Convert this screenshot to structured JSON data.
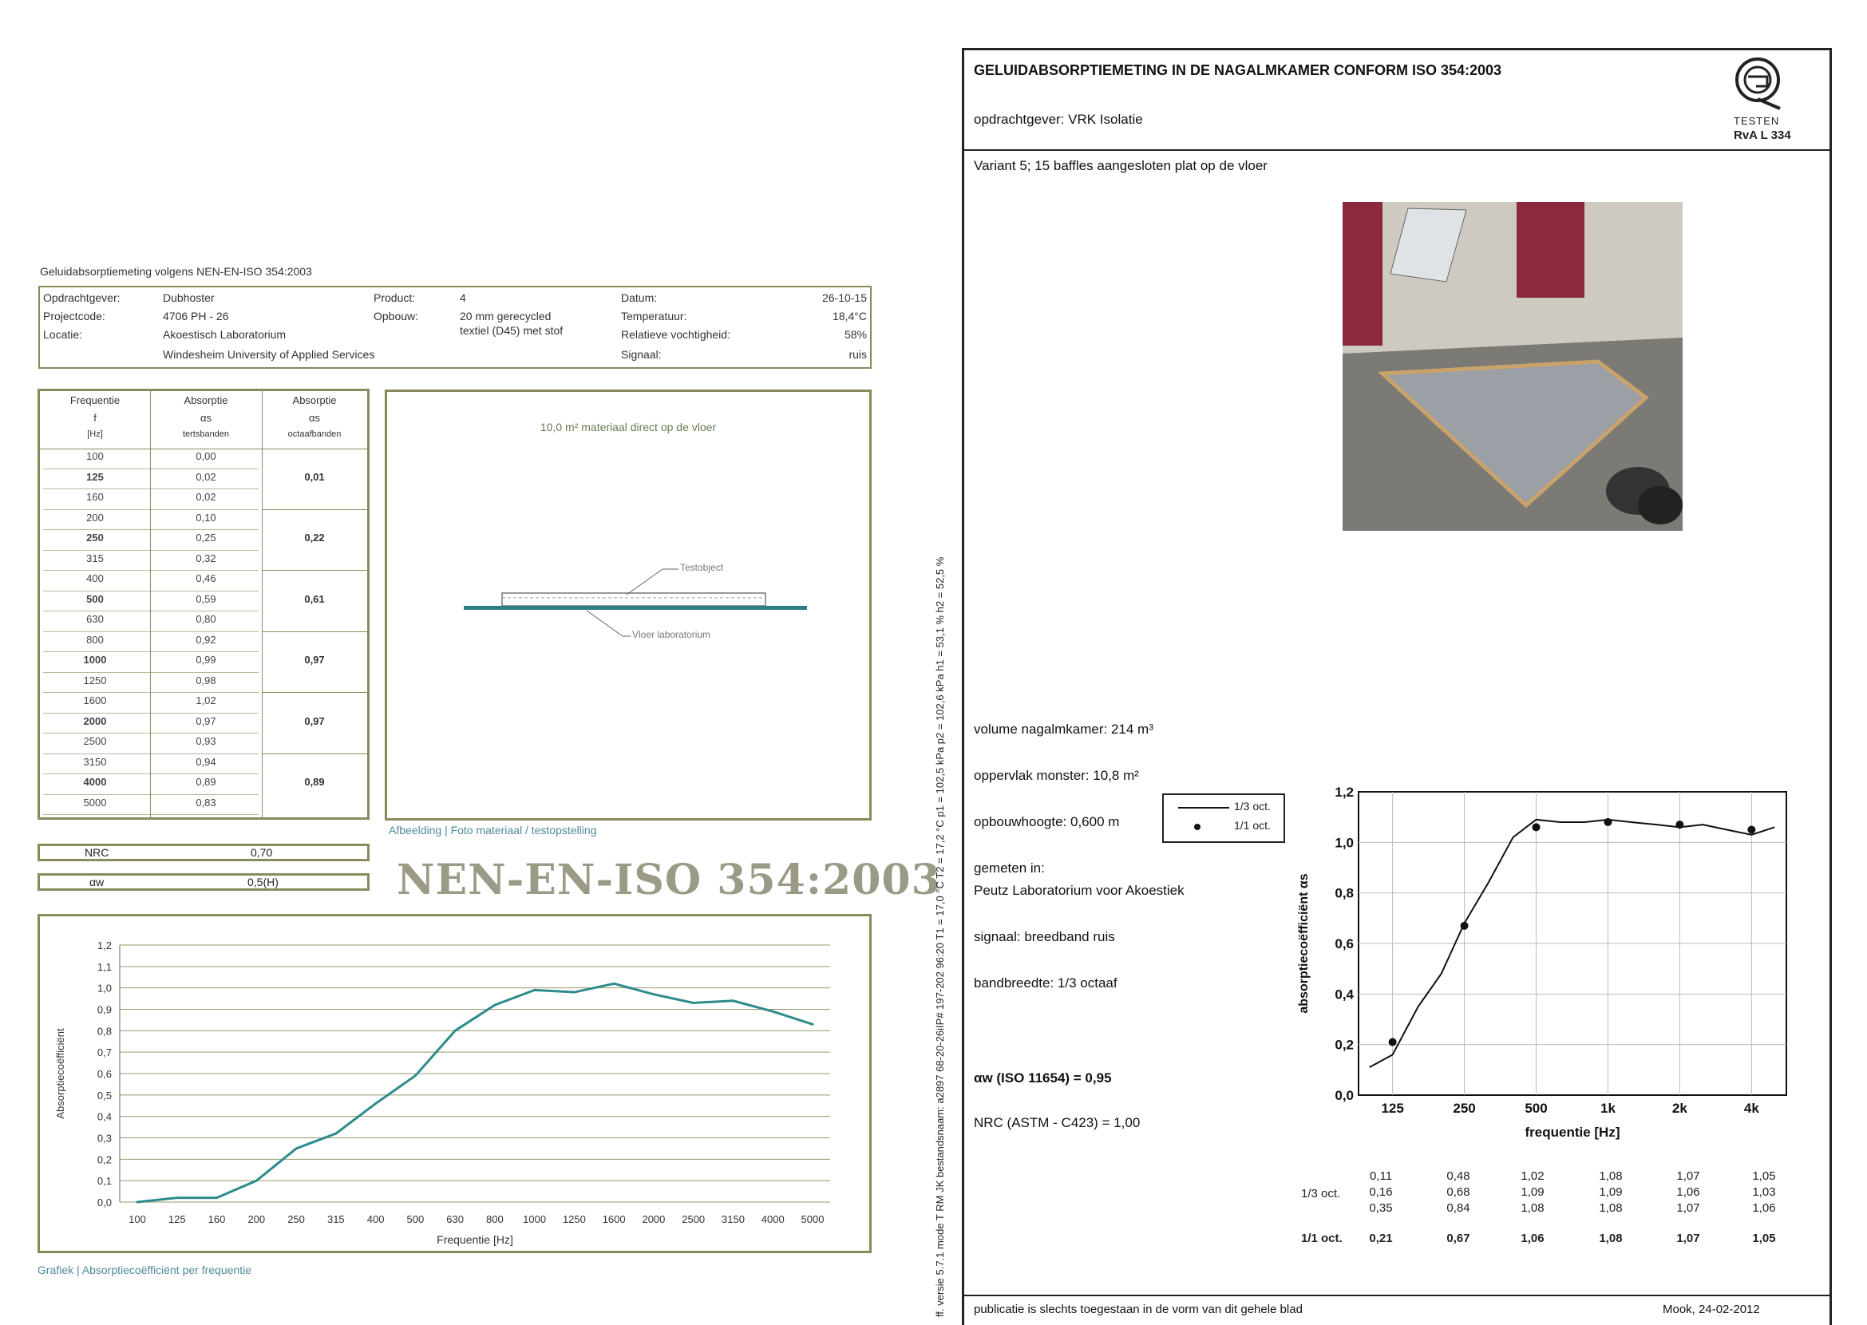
{
  "left_report": {
    "title": "Geluidabsorptiemeting volgens NEN-EN-ISO 354:2003",
    "meta": {
      "client_label": "Opdrachtgever:",
      "client_value": "Dubhoster",
      "project_label": "Projectcode:",
      "project_value": "4706 PH - 26",
      "location_label": "Locatie:",
      "location_value": "Akoestisch Laboratorium",
      "location_value2": "Windesheim University of Applied Services",
      "product_label": "Product:",
      "product_value": "4",
      "build_label": "Opbouw:",
      "build_value": "20 mm gerecycled",
      "build_value2": "textiel (D45) met stof",
      "date_label": "Datum:",
      "date_value": "26-10-15",
      "temp_label": "Temperatuur:",
      "temp_value": "18,4°C",
      "humidity_label": "Relatieve vochtigheid:",
      "humidity_value": "58%",
      "signal_label": "Signaal:",
      "signal_value": "ruis"
    },
    "table": {
      "headers": [
        [
          "Frequentie",
          "f",
          "[Hz]"
        ],
        [
          "Absorptie",
          "αs",
          "tertsbanden"
        ],
        [
          "Absorptie",
          "αs",
          "octaafbanden"
        ]
      ],
      "rows": [
        {
          "f": "100",
          "third": "0,00"
        },
        {
          "f": "125",
          "third": "0,02"
        },
        {
          "f": "160",
          "third": "0,02"
        },
        {
          "f": "200",
          "third": "0,10"
        },
        {
          "f": "250",
          "third": "0,25"
        },
        {
          "f": "315",
          "third": "0,32"
        },
        {
          "f": "400",
          "third": "0,46"
        },
        {
          "f": "500",
          "third": "0,59"
        },
        {
          "f": "630",
          "third": "0,80"
        },
        {
          "f": "800",
          "third": "0,92"
        },
        {
          "f": "1000",
          "third": "0,99"
        },
        {
          "f": "1250",
          "third": "0,98"
        },
        {
          "f": "1600",
          "third": "1,02"
        },
        {
          "f": "2000",
          "third": "0,97"
        },
        {
          "f": "2500",
          "third": "0,93"
        },
        {
          "f": "3150",
          "third": "0,94"
        },
        {
          "f": "4000",
          "third": "0,89"
        },
        {
          "f": "5000",
          "third": "0,83"
        }
      ],
      "octave": [
        "0,01",
        "0,22",
        "0,61",
        "0,97",
        "0,97",
        "0,89"
      ]
    },
    "nrc_label": "NRC",
    "nrc_value": "0,70",
    "aw_label": "αw",
    "aw_value": "0,5(H)",
    "drawing_title": "10,0 m² materiaal direct op de vloer",
    "drawing_label_top": "Testobject",
    "drawing_label_bottom": "Vloer laboratorium",
    "drawing_caption": "Afbeelding | Foto materiaal / testopstelling",
    "standard_title": "NEN-EN-ISO 354:2003",
    "chart_caption": "Grafiek | Absorptiecoëfficiënt per frequentie"
  },
  "right_report": {
    "title": "GELUIDABSORPTIEMETING IN DE NAGALMKAMER CONFORM ISO 354:2003",
    "client": "opdrachtgever: VRK Isolatie",
    "logo_line1": "TESTEN",
    "logo_line2": "RvA L 334",
    "variant": "Variant 5; 15 baffles aangesloten plat op de vloer",
    "volume": "volume nagalmkamer: 214 m³",
    "area": "oppervlak monster: 10,8 m²",
    "height": "opbouwhoogte: 0,600 m",
    "measured_in": "gemeten in:",
    "lab": "Peutz Laboratorium voor Akoestiek",
    "signal": "signaal: breedband ruis",
    "bandwidth": "bandbreedte: 1/3 octaaf",
    "aw": "αw (ISO 11654) = 0,95",
    "nrc": "NRC (ASTM - C423) = 1,00",
    "legend_third": "1/3 oct.",
    "legend_oct": "1/1 oct.",
    "third_label": "1/3 oct.",
    "oct_label": "1/1 oct.",
    "values_rows": [
      [
        "0,11",
        "0,48",
        "1,02",
        "1,08",
        "1,07",
        "1,05"
      ],
      [
        "0,16",
        "0,68",
        "1,09",
        "1,09",
        "1,06",
        "1,03"
      ],
      [
        "0,35",
        "0,84",
        "1,08",
        "1,08",
        "1,07",
        "1,06"
      ]
    ],
    "oct_values": [
      "0,21",
      "0,67",
      "1,06",
      "1,08",
      "1,07",
      "1,05"
    ],
    "footer_left": "publicatie is slechts toegestaan in de vorm van dit gehele blad",
    "footer_right": "Mook, 24-02-2012",
    "side_text": "ff. versie 5.7.1 mode T RM  JK bestandsnaam: a2897 68-20-26iIP# 197-202  96:20 T1 = 17,0 °C T2 = 17,2 °C p1 = 102,5 kPa p2 = 102,6 kPa h1 = 53,1 % h2 = 52,5 %"
  },
  "chart_data": [
    {
      "type": "line",
      "title": "",
      "xlabel": "Frequentie [Hz]",
      "ylabel": "Absorptiecoëfficiënt",
      "categories": [
        "100",
        "125",
        "160",
        "200",
        "250",
        "315",
        "400",
        "500",
        "630",
        "800",
        "1000",
        "1250",
        "1600",
        "2000",
        "2500",
        "3150",
        "4000",
        "5000"
      ],
      "values": [
        0.0,
        0.02,
        0.02,
        0.1,
        0.25,
        0.32,
        0.46,
        0.59,
        0.8,
        0.92,
        0.99,
        0.98,
        1.02,
        0.97,
        0.93,
        0.94,
        0.89,
        0.83
      ],
      "yticks": [
        "0,0",
        "0,1",
        "0,2",
        "0,3",
        "0,4",
        "0,5",
        "0,6",
        "0,7",
        "0,8",
        "0,9",
        "1,0",
        "1,1",
        "1,2"
      ],
      "ylim": [
        0,
        1.2
      ],
      "grid": true,
      "color": "#2e8b8b"
    },
    {
      "type": "line",
      "title": "",
      "xlabel": "frequentie [Hz]",
      "ylabel": "absorptiecoëfficiënt αs",
      "xtick_labels": [
        "125",
        "250",
        "500",
        "1k",
        "2k",
        "4k"
      ],
      "series": [
        {
          "name": "1/3 oct.",
          "x": [
            100,
            125,
            160,
            200,
            250,
            315,
            400,
            500,
            630,
            800,
            1000,
            1250,
            1600,
            2000,
            2500,
            3150,
            4000,
            5000
          ],
          "values": [
            0.11,
            0.16,
            0.35,
            0.48,
            0.68,
            0.84,
            1.02,
            1.09,
            1.08,
            1.08,
            1.09,
            1.08,
            1.07,
            1.06,
            1.07,
            1.05,
            1.03,
            1.06
          ]
        },
        {
          "name": "1/1 oct.",
          "x": [
            125,
            250,
            500,
            1000,
            2000,
            4000
          ],
          "values": [
            0.21,
            0.67,
            1.06,
            1.08,
            1.07,
            1.05
          ]
        }
      ],
      "yticks": [
        "0,0",
        "0,2",
        "0,4",
        "0,6",
        "0,8",
        "1,0",
        "1,2"
      ],
      "ylim": [
        0,
        1.2
      ],
      "grid": true,
      "color": "#111111"
    }
  ]
}
